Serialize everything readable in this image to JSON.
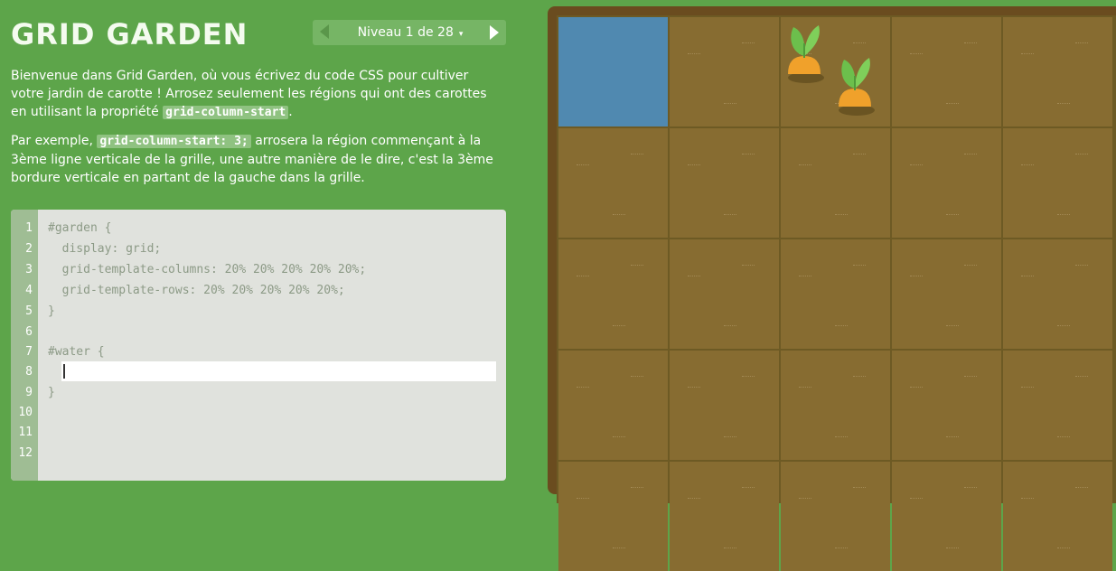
{
  "header": {
    "title": "GRID GARDEN",
    "level_label": "Niveau 1 de 28",
    "level_caret": "▾"
  },
  "instructions": {
    "p1_text": "Bienvenue dans Grid Garden, où vous écrivez du code CSS pour cultiver votre jardin de carotte ! Arrosez seulement les régions qui ont des carottes en utilisant la propriété ",
    "p1_code": "grid-column-start",
    "p1_end": ".",
    "p2_start": "Par exemple, ",
    "p2_code": "grid-column-start: 3;",
    "p2_text": " arrosera la région commençant à la 3ème ligne verticale de la grille, une autre manière de le dire, c'est la 3ème bordure verticale en partant de la gauche dans la grille."
  },
  "editor": {
    "line_numbers": [
      "1",
      "2",
      "3",
      "4",
      "5",
      "6",
      "7",
      "8",
      "9",
      "10",
      "11",
      "12"
    ],
    "lines": [
      "#garden {",
      "  display: grid;",
      "  grid-template-columns: 20% 20% 20% 20% 20%;",
      "  grid-template-rows: 20% 20% 20% 20% 20%;",
      "}",
      "",
      "#water {",
      "",
      "}"
    ],
    "input_value": "",
    "input_placeholder": ""
  },
  "garden": {
    "rows": 5,
    "columns": 5,
    "water_cell": {
      "row": 1,
      "column": 1
    },
    "carrot_cells": [
      {
        "row": 1,
        "column": 3
      },
      {
        "row": 1,
        "column": 3
      }
    ],
    "colors": {
      "background": "#5da54a",
      "soil": "#876c31",
      "water": "#5089b0",
      "carrot": "#f0a12b",
      "leaf": "#6cbf4c"
    }
  }
}
